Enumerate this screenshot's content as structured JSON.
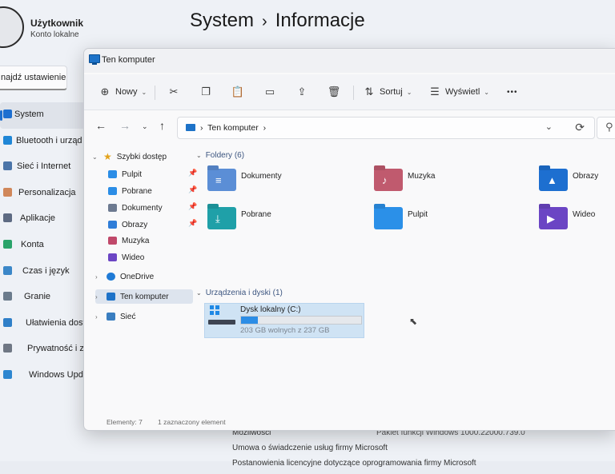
{
  "settings": {
    "user_name": "Użytkownik",
    "user_sub": "Konto lokalne",
    "search_placeholder": "najdź ustawienie",
    "title_part1": "System",
    "title_sep": "›",
    "title_part2": "Informacje",
    "nav": [
      {
        "label": "System",
        "active": true,
        "color": "#1e6fd0"
      },
      {
        "label": "Bluetooth i urząd",
        "color": "#1f86d6"
      },
      {
        "label": "Sieć i Internet",
        "color": "#4a74a8"
      },
      {
        "label": "Personalizacja",
        "color": "#d0875a"
      },
      {
        "label": "Aplikacje",
        "color": "#5d6a82"
      },
      {
        "label": "Konta",
        "color": "#2aa36a"
      },
      {
        "label": "Czas i język",
        "color": "#3b87c8"
      },
      {
        "label": "Granie",
        "color": "#6b7b8c"
      },
      {
        "label": "Ułatwienia dostęp",
        "color": "#2f7fc8"
      },
      {
        "label": "Prywatność i zabe",
        "color": "#6f7784"
      },
      {
        "label": "Windows Update",
        "color": "#2d86d0"
      }
    ],
    "bottom": {
      "capabilities": "Możliwości",
      "capabilities_value": "Pakiet funkcji Windows 1000.22000.739.0",
      "agreement": "Umowa o świadczenie usług firmy Microsoft",
      "license": "Postanowienia licencyjne dotyczące oprogramowania firmy Microsoft"
    }
  },
  "explorer": {
    "title": "Ten komputer",
    "toolbar": {
      "new_label": "Nowy",
      "sort_label": "Sortuj",
      "view_label": "Wyświetl",
      "more_label": "•••"
    },
    "address": {
      "crumb": "Ten komputer",
      "sep": "›"
    },
    "nav": {
      "quick_access": "Szybki dostęp",
      "pinned": [
        {
          "label": "Pulpit",
          "color": "#2b8de6"
        },
        {
          "label": "Pobrane",
          "color": "#2b8de6"
        },
        {
          "label": "Dokumenty",
          "color": "#6d7a90"
        },
        {
          "label": "Obrazy",
          "color": "#2f7dd8"
        }
      ],
      "other": [
        {
          "label": "Muzyka",
          "color": "#c0486a"
        },
        {
          "label": "Wideo",
          "color": "#6b45c4"
        }
      ],
      "onedrive": "OneDrive",
      "this_pc": "Ten komputer",
      "network": "Sieć"
    },
    "content": {
      "folders_header": "Foldery (6)",
      "folders": [
        {
          "label": "Dokumenty",
          "color": "#5b8ed6"
        },
        {
          "label": "Muzyka",
          "color": "#c05a6e"
        },
        {
          "label": "Obrazy",
          "color": "#1d6fd0"
        },
        {
          "label": "Pobrane",
          "color": "#1fa0a8"
        },
        {
          "label": "Pulpit",
          "color": "#2b90e8"
        },
        {
          "label": "Wideo",
          "color": "#6b45c4"
        }
      ],
      "devices_header": "Urządzenia i dyski (1)",
      "drive": {
        "name": "Dysk lokalny (C:)",
        "free_text": "203 GB wolnych z 237 GB",
        "used_fraction": 0.143
      }
    },
    "status": {
      "items": "Elementy: 7",
      "selected": "1 zaznaczony element"
    }
  }
}
